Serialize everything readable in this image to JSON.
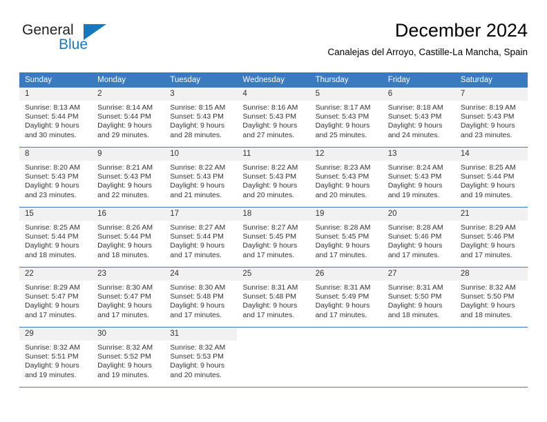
{
  "brand": {
    "name_primary": "General",
    "name_secondary": "Blue",
    "triangle_color": "#1878be",
    "primary_color": "#231f20"
  },
  "header": {
    "title": "December 2024",
    "subtitle": "Canalejas del Arroyo, Castille-La Mancha, Spain"
  },
  "theme": {
    "accent": "#3a7ac1",
    "daynum_band": "#f1f1f1",
    "text": "#333333"
  },
  "weekday_headers": [
    "Sunday",
    "Monday",
    "Tuesday",
    "Wednesday",
    "Thursday",
    "Friday",
    "Saturday"
  ],
  "weeks": [
    [
      {
        "day": "1",
        "sunrise": "Sunrise: 8:13 AM",
        "sunset": "Sunset: 5:44 PM",
        "daylight1": "Daylight: 9 hours",
        "daylight2": "and 30 minutes."
      },
      {
        "day": "2",
        "sunrise": "Sunrise: 8:14 AM",
        "sunset": "Sunset: 5:44 PM",
        "daylight1": "Daylight: 9 hours",
        "daylight2": "and 29 minutes."
      },
      {
        "day": "3",
        "sunrise": "Sunrise: 8:15 AM",
        "sunset": "Sunset: 5:43 PM",
        "daylight1": "Daylight: 9 hours",
        "daylight2": "and 28 minutes."
      },
      {
        "day": "4",
        "sunrise": "Sunrise: 8:16 AM",
        "sunset": "Sunset: 5:43 PM",
        "daylight1": "Daylight: 9 hours",
        "daylight2": "and 27 minutes."
      },
      {
        "day": "5",
        "sunrise": "Sunrise: 8:17 AM",
        "sunset": "Sunset: 5:43 PM",
        "daylight1": "Daylight: 9 hours",
        "daylight2": "and 25 minutes."
      },
      {
        "day": "6",
        "sunrise": "Sunrise: 8:18 AM",
        "sunset": "Sunset: 5:43 PM",
        "daylight1": "Daylight: 9 hours",
        "daylight2": "and 24 minutes."
      },
      {
        "day": "7",
        "sunrise": "Sunrise: 8:19 AM",
        "sunset": "Sunset: 5:43 PM",
        "daylight1": "Daylight: 9 hours",
        "daylight2": "and 23 minutes."
      }
    ],
    [
      {
        "day": "8",
        "sunrise": "Sunrise: 8:20 AM",
        "sunset": "Sunset: 5:43 PM",
        "daylight1": "Daylight: 9 hours",
        "daylight2": "and 23 minutes."
      },
      {
        "day": "9",
        "sunrise": "Sunrise: 8:21 AM",
        "sunset": "Sunset: 5:43 PM",
        "daylight1": "Daylight: 9 hours",
        "daylight2": "and 22 minutes."
      },
      {
        "day": "10",
        "sunrise": "Sunrise: 8:22 AM",
        "sunset": "Sunset: 5:43 PM",
        "daylight1": "Daylight: 9 hours",
        "daylight2": "and 21 minutes."
      },
      {
        "day": "11",
        "sunrise": "Sunrise: 8:22 AM",
        "sunset": "Sunset: 5:43 PM",
        "daylight1": "Daylight: 9 hours",
        "daylight2": "and 20 minutes."
      },
      {
        "day": "12",
        "sunrise": "Sunrise: 8:23 AM",
        "sunset": "Sunset: 5:43 PM",
        "daylight1": "Daylight: 9 hours",
        "daylight2": "and 20 minutes."
      },
      {
        "day": "13",
        "sunrise": "Sunrise: 8:24 AM",
        "sunset": "Sunset: 5:43 PM",
        "daylight1": "Daylight: 9 hours",
        "daylight2": "and 19 minutes."
      },
      {
        "day": "14",
        "sunrise": "Sunrise: 8:25 AM",
        "sunset": "Sunset: 5:44 PM",
        "daylight1": "Daylight: 9 hours",
        "daylight2": "and 19 minutes."
      }
    ],
    [
      {
        "day": "15",
        "sunrise": "Sunrise: 8:25 AM",
        "sunset": "Sunset: 5:44 PM",
        "daylight1": "Daylight: 9 hours",
        "daylight2": "and 18 minutes."
      },
      {
        "day": "16",
        "sunrise": "Sunrise: 8:26 AM",
        "sunset": "Sunset: 5:44 PM",
        "daylight1": "Daylight: 9 hours",
        "daylight2": "and 18 minutes."
      },
      {
        "day": "17",
        "sunrise": "Sunrise: 8:27 AM",
        "sunset": "Sunset: 5:44 PM",
        "daylight1": "Daylight: 9 hours",
        "daylight2": "and 17 minutes."
      },
      {
        "day": "18",
        "sunrise": "Sunrise: 8:27 AM",
        "sunset": "Sunset: 5:45 PM",
        "daylight1": "Daylight: 9 hours",
        "daylight2": "and 17 minutes."
      },
      {
        "day": "19",
        "sunrise": "Sunrise: 8:28 AM",
        "sunset": "Sunset: 5:45 PM",
        "daylight1": "Daylight: 9 hours",
        "daylight2": "and 17 minutes."
      },
      {
        "day": "20",
        "sunrise": "Sunrise: 8:28 AM",
        "sunset": "Sunset: 5:46 PM",
        "daylight1": "Daylight: 9 hours",
        "daylight2": "and 17 minutes."
      },
      {
        "day": "21",
        "sunrise": "Sunrise: 8:29 AM",
        "sunset": "Sunset: 5:46 PM",
        "daylight1": "Daylight: 9 hours",
        "daylight2": "and 17 minutes."
      }
    ],
    [
      {
        "day": "22",
        "sunrise": "Sunrise: 8:29 AM",
        "sunset": "Sunset: 5:47 PM",
        "daylight1": "Daylight: 9 hours",
        "daylight2": "and 17 minutes."
      },
      {
        "day": "23",
        "sunrise": "Sunrise: 8:30 AM",
        "sunset": "Sunset: 5:47 PM",
        "daylight1": "Daylight: 9 hours",
        "daylight2": "and 17 minutes."
      },
      {
        "day": "24",
        "sunrise": "Sunrise: 8:30 AM",
        "sunset": "Sunset: 5:48 PM",
        "daylight1": "Daylight: 9 hours",
        "daylight2": "and 17 minutes."
      },
      {
        "day": "25",
        "sunrise": "Sunrise: 8:31 AM",
        "sunset": "Sunset: 5:48 PM",
        "daylight1": "Daylight: 9 hours",
        "daylight2": "and 17 minutes."
      },
      {
        "day": "26",
        "sunrise": "Sunrise: 8:31 AM",
        "sunset": "Sunset: 5:49 PM",
        "daylight1": "Daylight: 9 hours",
        "daylight2": "and 17 minutes."
      },
      {
        "day": "27",
        "sunrise": "Sunrise: 8:31 AM",
        "sunset": "Sunset: 5:50 PM",
        "daylight1": "Daylight: 9 hours",
        "daylight2": "and 18 minutes."
      },
      {
        "day": "28",
        "sunrise": "Sunrise: 8:32 AM",
        "sunset": "Sunset: 5:50 PM",
        "daylight1": "Daylight: 9 hours",
        "daylight2": "and 18 minutes."
      }
    ],
    [
      {
        "day": "29",
        "sunrise": "Sunrise: 8:32 AM",
        "sunset": "Sunset: 5:51 PM",
        "daylight1": "Daylight: 9 hours",
        "daylight2": "and 19 minutes."
      },
      {
        "day": "30",
        "sunrise": "Sunrise: 8:32 AM",
        "sunset": "Sunset: 5:52 PM",
        "daylight1": "Daylight: 9 hours",
        "daylight2": "and 19 minutes."
      },
      {
        "day": "31",
        "sunrise": "Sunrise: 8:32 AM",
        "sunset": "Sunset: 5:53 PM",
        "daylight1": "Daylight: 9 hours",
        "daylight2": "and 20 minutes."
      },
      {
        "day": "",
        "sunrise": "",
        "sunset": "",
        "daylight1": "",
        "daylight2": ""
      },
      {
        "day": "",
        "sunrise": "",
        "sunset": "",
        "daylight1": "",
        "daylight2": ""
      },
      {
        "day": "",
        "sunrise": "",
        "sunset": "",
        "daylight1": "",
        "daylight2": ""
      },
      {
        "day": "",
        "sunrise": "",
        "sunset": "",
        "daylight1": "",
        "daylight2": ""
      }
    ]
  ]
}
